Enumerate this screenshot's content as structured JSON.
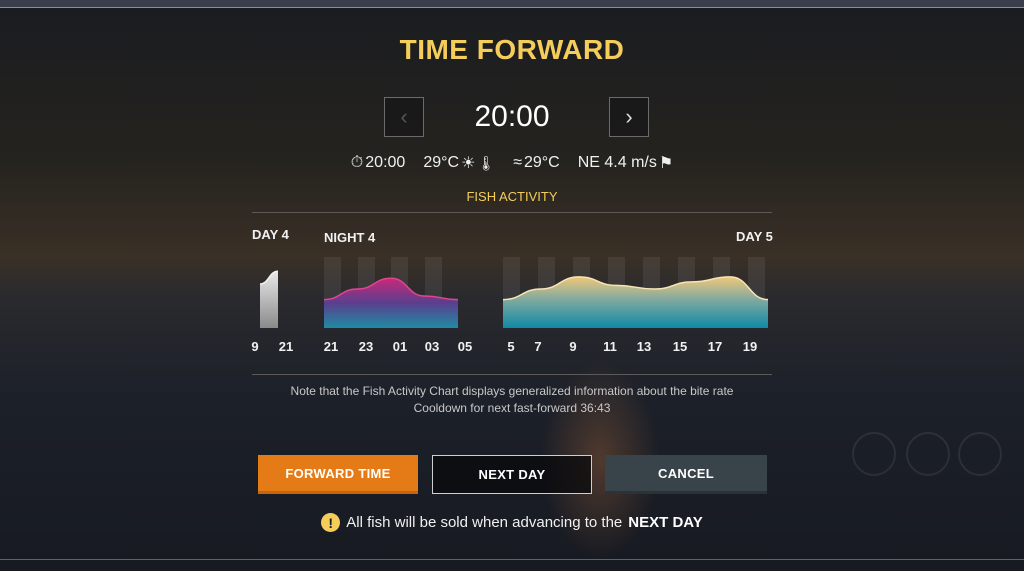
{
  "title": "TIME FORWARD",
  "time": "20:00",
  "weather": {
    "clock_time": "20:00",
    "air_temp": "29°C",
    "water_temp": "29°C",
    "wind": "NE 4.4 m/s"
  },
  "fish_activity_title": "FISH ACTIVITY",
  "segments": {
    "day4": "DAY 4",
    "night4": "NIGHT 4",
    "day5": "DAY 5"
  },
  "ticks": [
    "9",
    "21",
    "21",
    "23",
    "01",
    "03",
    "05",
    "5",
    "7",
    "9",
    "11",
    "13",
    "15",
    "17",
    "19"
  ],
  "chart_data": {
    "type": "area",
    "title": "FISH ACTIVITY",
    "series": [
      {
        "name": "DAY 4",
        "x": [
          "9",
          "21"
        ],
        "values": [
          0.62,
          0.8
        ],
        "color": "#d9d9d9"
      },
      {
        "name": "NIGHT 4",
        "x": [
          "21",
          "23",
          "01",
          "03",
          "05"
        ],
        "values": [
          0.4,
          0.55,
          0.7,
          0.45,
          0.4
        ],
        "color": "#d6387f"
      },
      {
        "name": "DAY 5",
        "x": [
          "5",
          "7",
          "9",
          "11",
          "13",
          "15",
          "17",
          "19"
        ],
        "values": [
          0.4,
          0.55,
          0.72,
          0.6,
          0.55,
          0.65,
          0.72,
          0.4
        ],
        "color": "#e9c77a"
      }
    ]
  },
  "note_line1": "Note that the Fish Activity Chart displays generalized information about the bite rate",
  "note_line2": "Cooldown for next fast-forward 36:43",
  "buttons": {
    "forward": "FORWARD TIME",
    "next_day": "NEXT DAY",
    "cancel": "CANCEL"
  },
  "warning": {
    "text": "All fish will be sold when advancing to the",
    "emphasis": "NEXT DAY"
  },
  "icons": {
    "prev": "chevron-left-icon",
    "next": "chevron-right-icon",
    "clock": "stopwatch-icon",
    "sun": "sun-icon",
    "thermometer": "thermometer-icon",
    "water": "water-waves-icon",
    "wind": "wind-flag-icon",
    "warning": "exclamation-icon"
  },
  "colors": {
    "accent": "#f5cd5a",
    "forward_button": "#e57b17",
    "cancel_button": "#39444a"
  }
}
